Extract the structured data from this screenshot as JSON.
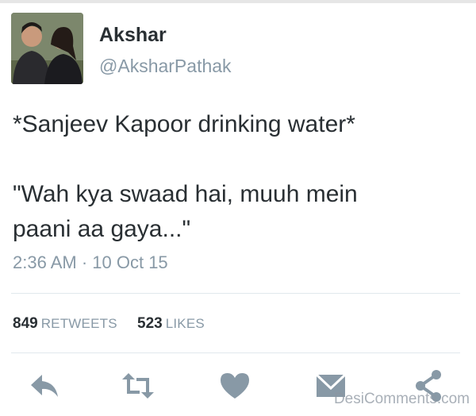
{
  "user": {
    "name": "Akshar",
    "handle": "@AksharPathak"
  },
  "tweet": {
    "text": "*Sanjeev Kapoor drinking water*\n\n\"Wah kya swaad hai, muuh mein\npaani aa gaya...\"",
    "timestamp": "2:36 AM · 10 Oct 15"
  },
  "stats": {
    "retweets_count": "849",
    "retweets_label": "RETWEETS",
    "likes_count": "523",
    "likes_label": "LIKES"
  },
  "actions": {
    "icons": [
      "reply-icon",
      "retweet-icon",
      "like-icon",
      "message-icon",
      "share-icon"
    ],
    "icon_color": "#8899a6"
  },
  "watermark": "DesiComments.com",
  "colors": {
    "text": "#292f33",
    "secondary": "#8899a6",
    "divider": "#e1e8ed"
  }
}
